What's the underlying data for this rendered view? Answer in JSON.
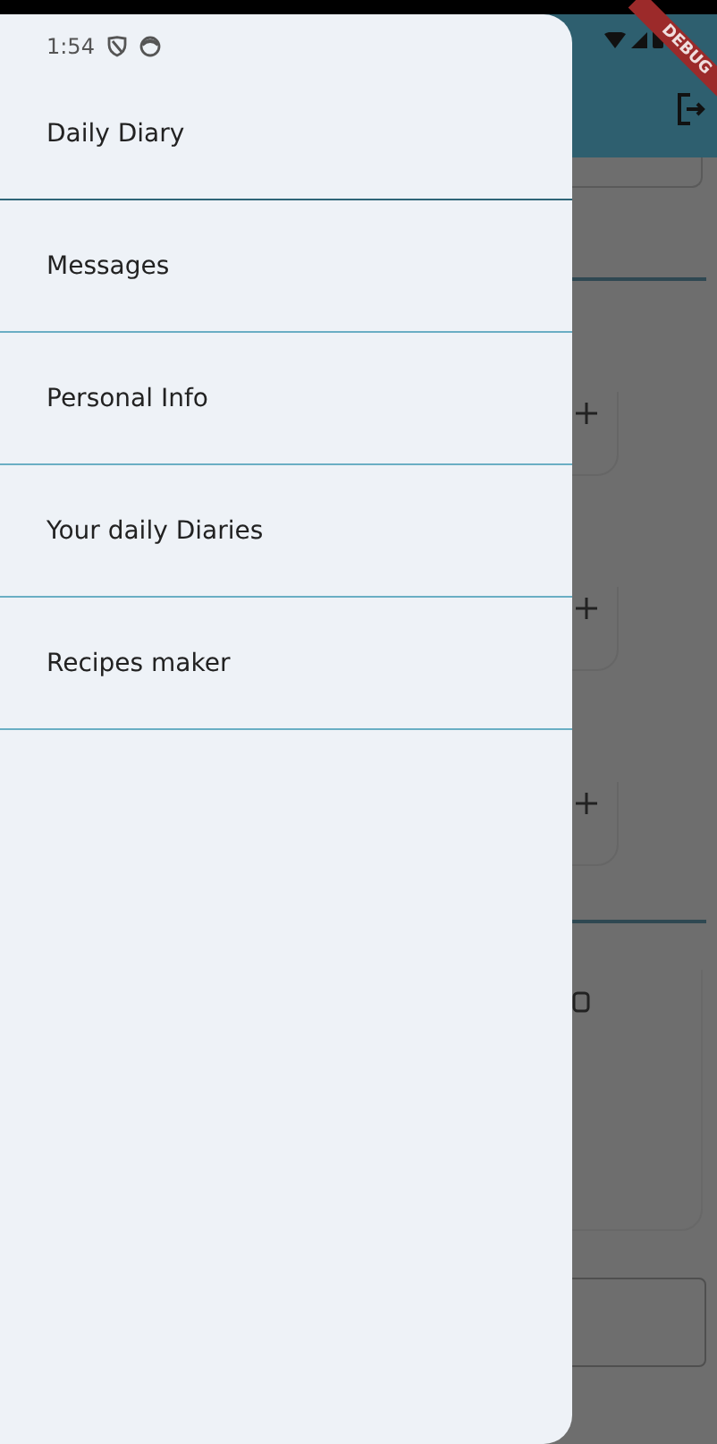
{
  "status_bar": {
    "time": "1:54"
  },
  "debug_banner": "DEBUG",
  "drawer": {
    "items": [
      {
        "label": "Daily Diary"
      },
      {
        "label": "Messages"
      },
      {
        "label": "Personal Info"
      },
      {
        "label": "Your daily Diaries"
      },
      {
        "label": "Recipes maker"
      }
    ]
  }
}
